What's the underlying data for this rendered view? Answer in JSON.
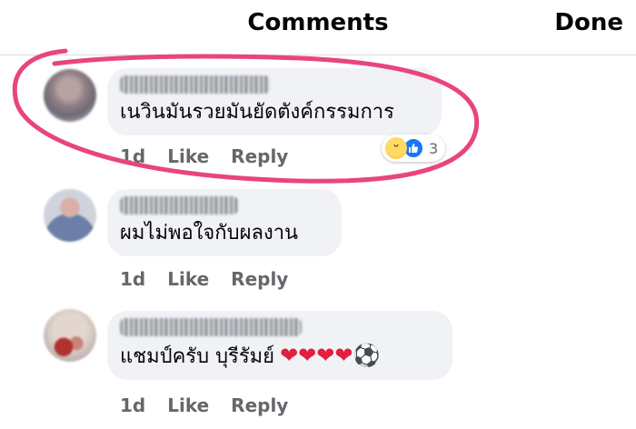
{
  "header": {
    "title": "Comments",
    "done_label": "Done"
  },
  "comments": [
    {
      "text": "เนวินมันรวยมันยัดตังค์กรรมการ",
      "time": "1d",
      "like_label": "Like",
      "reply_label": "Reply",
      "reactions": {
        "icons": [
          "haha-icon",
          "like-icon"
        ],
        "count": "3"
      },
      "highlighted": true
    },
    {
      "text": "ผมไม่พอใจกับผลงาน",
      "time": "1d",
      "like_label": "Like",
      "reply_label": "Reply"
    },
    {
      "text": "แชมป์ครับ บุรีรัมย์",
      "emoji": "❤❤❤❤",
      "emoji_tail": "⚽",
      "time": "1d",
      "like_label": "Like",
      "reply_label": "Reply"
    }
  ],
  "colors": {
    "highlight": "#e8457e",
    "bubble": "#f0f2f5",
    "action_text": "#65676b",
    "heart": "#e41e3f",
    "like_blue": "#1877f2"
  }
}
